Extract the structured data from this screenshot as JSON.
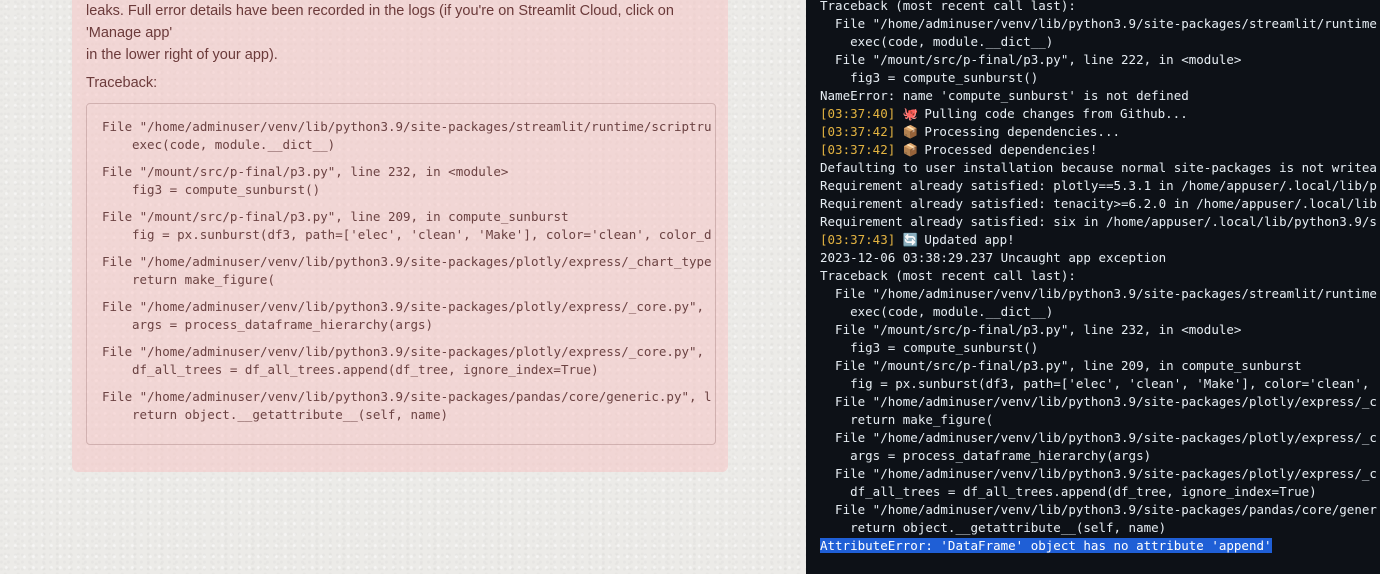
{
  "streamlit_error": {
    "intro_lines": [
      "leaks. Full error details have been recorded in the logs (if you're on Streamlit Cloud, click on 'Manage app'",
      "in the lower right of your app)."
    ],
    "traceback_label": "Traceback:",
    "frames": [
      {
        "file": "File \"/home/adminuser/venv/lib/python3.9/site-packages/streamlit/runtime/scriptru",
        "code": "exec(code, module.__dict__)"
      },
      {
        "file": "File \"/mount/src/p-final/p3.py\", line 232, in <module>",
        "code": "fig3 = compute_sunburst()"
      },
      {
        "file": "File \"/mount/src/p-final/p3.py\", line 209, in compute_sunburst",
        "code": "fig = px.sunburst(df3, path=['elec', 'clean', 'Make'], color='clean', color_d"
      },
      {
        "file": "File \"/home/adminuser/venv/lib/python3.9/site-packages/plotly/express/_chart_type",
        "code": "return make_figure("
      },
      {
        "file": "File \"/home/adminuser/venv/lib/python3.9/site-packages/plotly/express/_core.py\",",
        "code": "args = process_dataframe_hierarchy(args)"
      },
      {
        "file": "File \"/home/adminuser/venv/lib/python3.9/site-packages/plotly/express/_core.py\",",
        "code": "df_all_trees = df_all_trees.append(df_tree, ignore_index=True)"
      },
      {
        "file": "File \"/home/adminuser/venv/lib/python3.9/site-packages/pandas/core/generic.py\", l",
        "code": "return object.__getattribute__(self, name)"
      }
    ]
  },
  "terminal": {
    "lines": [
      {
        "text": "Traceback (most recent call last):"
      },
      {
        "text": "  File \"/home/adminuser/venv/lib/python3.9/site-packages/streamlit/runtime"
      },
      {
        "text": "    exec(code, module.__dict__)"
      },
      {
        "text": "  File \"/mount/src/p-final/p3.py\", line 222, in <module>"
      },
      {
        "text": "    fig3 = compute_sunburst()"
      },
      {
        "text": "NameError: name 'compute_sunburst' is not defined"
      },
      {
        "ts": "[03:37:40]",
        "icon": "octocat-icon",
        "icon_glyph": "🐙",
        "text": " Pulling code changes from Github..."
      },
      {
        "ts": "[03:37:42]",
        "icon": "package-icon",
        "icon_glyph": "📦",
        "text": " Processing dependencies..."
      },
      {
        "ts": "[03:37:42]",
        "icon": "package-icon",
        "icon_glyph": "📦",
        "text": " Processed dependencies!"
      },
      {
        "text": "Defaulting to user installation because normal site-packages is not writea"
      },
      {
        "text": "Requirement already satisfied: plotly==5.3.1 in /home/appuser/.local/lib/p"
      },
      {
        "text": "Requirement already satisfied: tenacity>=6.2.0 in /home/appuser/.local/lib"
      },
      {
        "text": "Requirement already satisfied: six in /home/appuser/.local/lib/python3.9/s"
      },
      {
        "ts": "[03:37:43]",
        "icon": "refresh-icon",
        "icon_glyph": "🔄",
        "text": " Updated app!"
      },
      {
        "text": "2023-12-06 03:38:29.237 Uncaught app exception"
      },
      {
        "text": "Traceback (most recent call last):"
      },
      {
        "text": "  File \"/home/adminuser/venv/lib/python3.9/site-packages/streamlit/runtime"
      },
      {
        "text": "    exec(code, module.__dict__)"
      },
      {
        "text": "  File \"/mount/src/p-final/p3.py\", line 232, in <module>"
      },
      {
        "text": "    fig3 = compute_sunburst()"
      },
      {
        "text": "  File \"/mount/src/p-final/p3.py\", line 209, in compute_sunburst"
      },
      {
        "text": "    fig = px.sunburst(df3, path=['elec', 'clean', 'Make'], color='clean',"
      },
      {
        "text": "  File \"/home/adminuser/venv/lib/python3.9/site-packages/plotly/express/_c"
      },
      {
        "text": "    return make_figure("
      },
      {
        "text": "  File \"/home/adminuser/venv/lib/python3.9/site-packages/plotly/express/_c"
      },
      {
        "text": "    args = process_dataframe_hierarchy(args)"
      },
      {
        "text": "  File \"/home/adminuser/venv/lib/python3.9/site-packages/plotly/express/_c"
      },
      {
        "text": "    df_all_trees = df_all_trees.append(df_tree, ignore_index=True)"
      },
      {
        "text": "  File \"/home/adminuser/venv/lib/python3.9/site-packages/pandas/core/gener"
      },
      {
        "text": "    return object.__getattribute__(self, name)"
      },
      {
        "text": "AttributeError: 'DataFrame' object has no attribute 'append'",
        "highlight": true
      }
    ]
  },
  "colors": {
    "terminal_bg": "#0d1117",
    "timestamp": "#e3b341",
    "selection": "#1f5fd6",
    "error_panel": "#f5c4c4"
  }
}
